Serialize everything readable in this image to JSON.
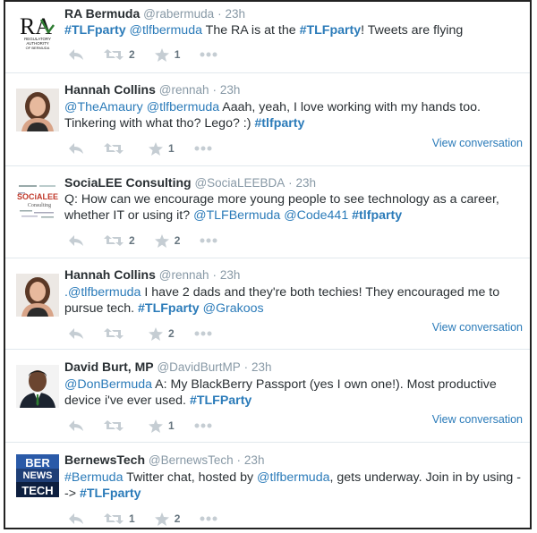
{
  "tweets": [
    {
      "name": "RA Bermuda",
      "handle": "@rabermuda",
      "dot": "·",
      "time": "23h",
      "text": [
        "#TLFparty",
        " ",
        "@tlfbermuda",
        "  The RA is at the ",
        "#TLFparty",
        "!  Tweets are flying"
      ],
      "retweets": "2",
      "favorites": "1",
      "view": "",
      "avatar": {
        "logo": "RA",
        "caption": "REGULATORY AUTHORITY OF BERMUDA"
      }
    },
    {
      "name": "Hannah Collins",
      "handle": "@rennah",
      "dot": "·",
      "time": "23h",
      "text": [
        "@TheAmaury",
        " ",
        "@tlfbermuda",
        " Aaah, yeah, I love working with my hands too. Tinkering with what tho? Lego? :) ",
        "#tlfparty"
      ],
      "retweets": "",
      "favorites": "1",
      "view": "View conversation"
    },
    {
      "name": "SociaLEE Consulting",
      "handle": "@SociaLEEBDA",
      "dot": "·",
      "time": "23h",
      "text": [
        "Q: How can we encourage more young people to see technology as a career, whether IT or using it? ",
        "@TLFBermuda",
        " ",
        "@Code441",
        " ",
        "#tlfparty"
      ],
      "retweets": "2",
      "favorites": "2",
      "view": "",
      "avatar": {
        "logo": "SOCIALEE Consulting"
      }
    },
    {
      "name": "Hannah Collins",
      "handle": "@rennah",
      "dot": "·",
      "time": "23h",
      "text": [
        ".@tlfbermuda",
        " I have 2 dads and they're both techies! They encouraged me to pursue tech. ",
        "#TLFparty",
        " ",
        "@Grakoos"
      ],
      "retweets": "",
      "favorites": "2",
      "view": "View conversation"
    },
    {
      "name": "David Burt, MP",
      "handle": "@DavidBurtMP",
      "dot": "·",
      "time": "23h",
      "text": [
        "@DonBermuda",
        " A: My BlackBerry Passport (yes I own one!). Most productive device i've ever used. ",
        "#TLFParty"
      ],
      "retweets": "",
      "favorites": "1",
      "view": "View conversation"
    },
    {
      "name": "BernewsTech",
      "handle": "@BernewsTech",
      "dot": "·",
      "time": "23h",
      "text": [
        "#Bermuda",
        " Twitter chat, hosted by ",
        "@tlfbermuda",
        ", gets underway. Join in by using --> ",
        "#TLFparty"
      ],
      "retweets": "1",
      "favorites": "2",
      "view": "",
      "avatar": {
        "logo_line1": "BER",
        "logo_line2": "NEWS",
        "logo_line3": "TECH"
      }
    }
  ],
  "colors": {
    "link": "#2b7bb9",
    "name": "#292f33",
    "meta": "#8899a6",
    "divider": "#e1e8ed"
  }
}
